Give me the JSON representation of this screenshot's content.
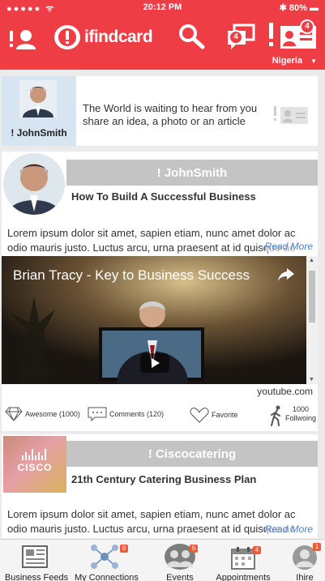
{
  "status_bar": {
    "time": "20:12 PM",
    "battery": "80%"
  },
  "header": {
    "logo_text": "ifindcard",
    "messages_badge": "4",
    "notifications_badge": "4",
    "country": "Nigeria"
  },
  "composer": {
    "user_name": "! JohnSmith",
    "prompt": "The World is waiting to hear from you share an idea, a photo or an article"
  },
  "posts": [
    {
      "author": "! JohnSmith",
      "title": "How To Build A Successful Business",
      "body": "Lorem ipsum dolor sit amet, sapien etiam, nunc amet dolor ac odio mauris justo. Luctus arcu, urna praesent at id quisque ac",
      "read_more": "Read More",
      "video_title": "Brian Tracy - Key to Business Success",
      "video_source": "youtube.com",
      "actions": {
        "awesome": "Awesome (1000)",
        "comments": "Comments (120)",
        "favorite": "Favorite",
        "follow_count": "1000",
        "follow_label": "Follwoing"
      }
    },
    {
      "author": "! Ciscocatering",
      "logo_word": "CISCO",
      "title": "21th  Century Catering Business Plan",
      "body": "Lorem ipsum dolor sit amet, sapien etiam, nunc amet dolor ac odio mauris justo. Luctus arcu, urna praesent at id quisque ac",
      "read_more": "Read More"
    }
  ],
  "bottom_nav": [
    {
      "label": "Business Feeds",
      "badge": ""
    },
    {
      "label": "My Connections",
      "badge": "6"
    },
    {
      "label": "Events",
      "badge": "6"
    },
    {
      "label": "Appointments",
      "badge": "4"
    },
    {
      "label": "Ihire",
      "badge": "1"
    }
  ],
  "colors": {
    "brand": "#ee3d45",
    "strip": "#c4c4c4",
    "link": "#4a7fc9"
  }
}
